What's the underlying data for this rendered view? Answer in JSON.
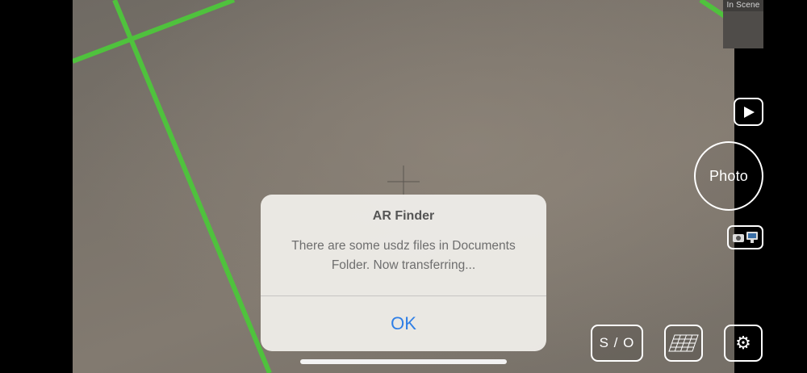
{
  "scene_thumbnail": {
    "label": "In Scene"
  },
  "controls": {
    "play_icon": "play-icon",
    "photo_label": "Photo",
    "mode_icon": "camera-monitor-icon",
    "so_label": "S / O",
    "plane_icon": "plane-grid-icon",
    "settings_icon": "gear-icon"
  },
  "alert": {
    "title": "AR Finder",
    "message": "There are some usdz files in Documents Folder. Now transferring...",
    "ok_label": "OK"
  },
  "colors": {
    "grid_line": "#4fc23d",
    "alert_button": "#2f7fe6",
    "alert_background": "#eeece8"
  }
}
